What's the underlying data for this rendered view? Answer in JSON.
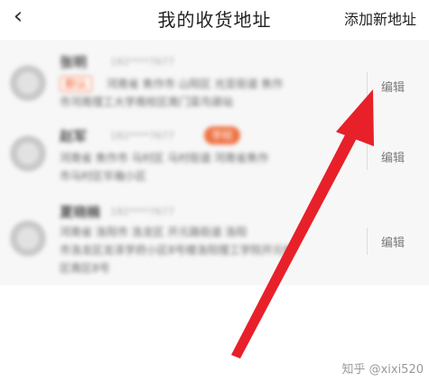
{
  "header": {
    "back_icon": "chevron-left-icon",
    "back_glyph": "‹",
    "title": "我的收货地址",
    "add_label": "添加新地址"
  },
  "addresses": [
    {
      "name": "张明",
      "phone": "182****7677",
      "tag": "默认",
      "line1": "河南省 焦作市 山阳区 光亚街道 焦作",
      "line2": "市河南理工大学南校区南门菜鸟驿站",
      "edit_label": "编辑"
    },
    {
      "name": "赵军",
      "phone": "182****7677",
      "tag": "学校",
      "line1": "河南省 焦作市 马村区 马村街道 河南省焦作",
      "line2": "市马村区华瀚小区",
      "edit_label": "编辑"
    },
    {
      "name": "夏晓楠",
      "phone": "182****7677",
      "tag": "",
      "line1": "河南省 洛阳市 洛龙区 开元路街道 洛阳",
      "line2": "市洛龙区龙泽学府小区8号楼洛阳理工学院开元校",
      "line3": "区南区8号",
      "edit_label": "编辑"
    }
  ],
  "watermark": "知乎 @xixi520",
  "colors": {
    "arrow": "#e8202a",
    "tag_orange": "#ee7244",
    "list_bg": "#f7f7f7"
  }
}
